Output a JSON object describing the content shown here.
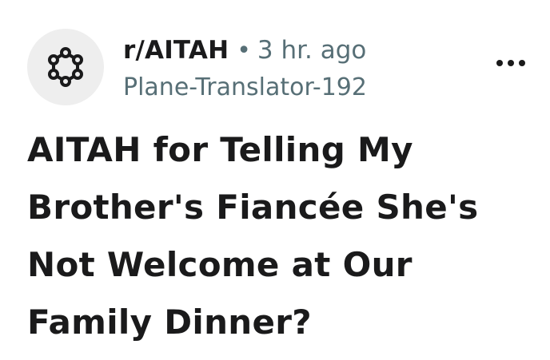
{
  "post": {
    "subreddit": "r/AITAH",
    "separator": "•",
    "time_ago": "3 hr. ago",
    "author": "Plane-Translator-192",
    "title": "AITAH for Telling My Brother's Fiancée She's Not Welcome at Our Family Dinner?",
    "avatar_icon": "subreddit-network-icon",
    "overflow_icon": "more-options-icon"
  },
  "colors": {
    "text_primary": "#1a1a1b",
    "text_secondary": "#576f76",
    "avatar_bg": "#eeeeee"
  }
}
